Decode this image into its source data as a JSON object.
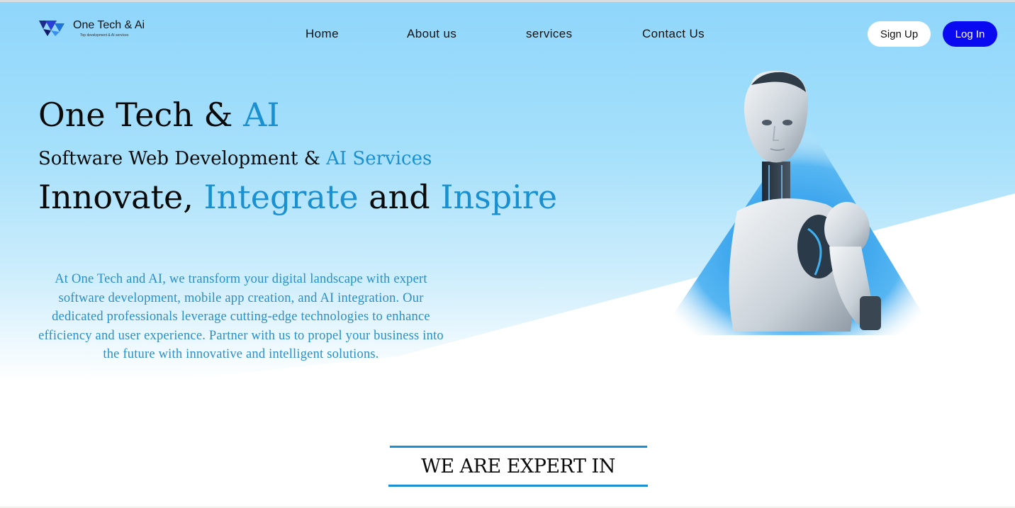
{
  "header": {
    "logo_name": "One Tech & Ai",
    "logo_tagline": "Top development & AI services",
    "logo_icon": "triangle-logo-icon"
  },
  "nav": {
    "items": [
      {
        "label": "Home"
      },
      {
        "label": "About us"
      },
      {
        "label": "services"
      },
      {
        "label": "Contact Us"
      }
    ]
  },
  "auth": {
    "signup_label": "Sign Up",
    "login_label": "Log In"
  },
  "hero": {
    "title_part1": "One Tech & ",
    "title_accent": "AI",
    "subtitle_part1": "Software Web Development & ",
    "subtitle_accent": "AI Services",
    "slogan_word1": "Innovate, ",
    "slogan_word2": "Integrate",
    "slogan_word3": " and ",
    "slogan_word4": "Inspire",
    "description": "At One Tech and AI, we transform your digital landscape with expert software development, mobile app creation, and AI integration. Our dedicated professionals leverage cutting-edge technologies to enhance efficiency and user experience. Partner with us to propel your business into the future with innovative and intelligent solutions.",
    "image": "humanoid-robot-image"
  },
  "section": {
    "heading": "WE ARE EXPERT IN"
  },
  "colors": {
    "accent": "#1a90d0",
    "login_button": "#0a0af0",
    "sky": "#8fd6fb"
  }
}
